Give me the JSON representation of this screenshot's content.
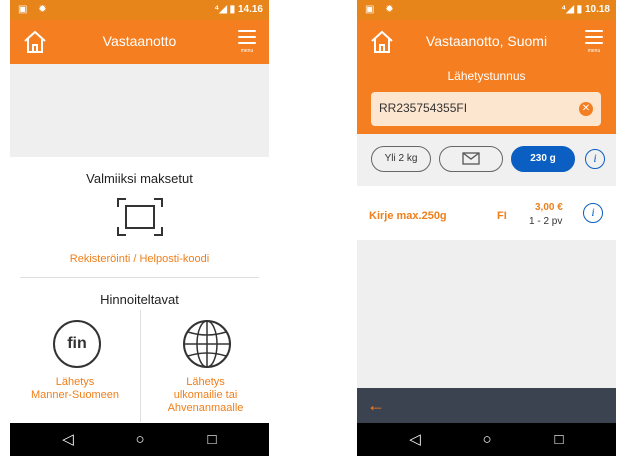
{
  "left": {
    "status": {
      "left_icons": "▣ ✹",
      "right": "⁴◢ ▮ 14.16"
    },
    "title": "Vastaanotto",
    "menu_label": "menu",
    "prepaid_title": "Valmiiksi maksetut",
    "register_link": "Rekisteröinti / Helposti-koodi",
    "priced_title": "Hinnoiteltavat",
    "fin_badge": "fin",
    "option_domestic": "Lähetys\nManner-Suomeen",
    "option_abroad": "Lähetys\nulkomailie tai\nAhvenanmaalle"
  },
  "right": {
    "status": {
      "left_icons": "▣ ✹",
      "right": "⁴◢ ▮ 10.18"
    },
    "title": "Vastaanotto, Suomi",
    "menu_label": "menu",
    "field_label": "Lähetystunnus",
    "tracking_code": "RR235754355FI",
    "filters": [
      "Yli 2 kg",
      "envelope",
      "230 g"
    ],
    "result": {
      "name": "Kirje max.250g",
      "country": "FI",
      "price": "3,00 €",
      "delivery": "1 - 2 pv"
    }
  },
  "nav": {
    "back": "◁",
    "home": "○",
    "recent": "□"
  },
  "colors": {
    "accent": "#f47e20",
    "selected": "#0b5fc2",
    "footer": "#3b4350"
  }
}
